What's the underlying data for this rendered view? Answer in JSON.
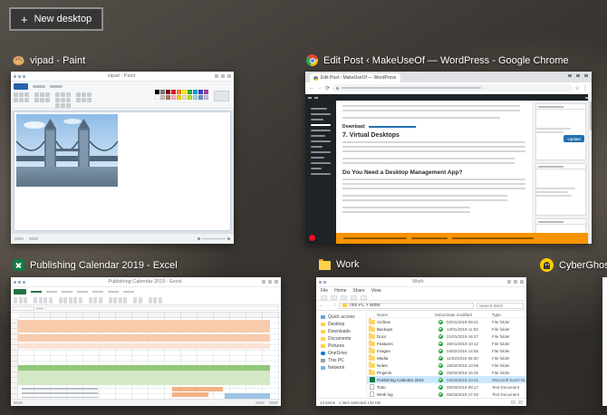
{
  "new_desktop": {
    "label": "New desktop",
    "plus": "+"
  },
  "windows": {
    "paint": {
      "label": "vipad - Paint",
      "title": "vipad - Paint",
      "palette": [
        "#000000",
        "#7f7f7f",
        "#880015",
        "#ed1c24",
        "#ff7f27",
        "#fff200",
        "#22b14c",
        "#00a2e8",
        "#3f48cc",
        "#a349a4",
        "#ffffff",
        "#c3c3c3",
        "#b97a57",
        "#ffaec9",
        "#ffc90e",
        "#efe4b0",
        "#b5e61d",
        "#99d9ea",
        "#7092be",
        "#c8bfe7"
      ]
    },
    "chrome": {
      "label": "Edit Post ‹ MakeUseOf — WordPress - Google Chrome",
      "tab_title": "Edit Post ‹ MakeUseOf — WordPress",
      "heading_virtual_desktops": "7. Virtual Desktops",
      "heading_management": "Do You Need a Desktop Management App?",
      "download_label": "Download:",
      "update_button": "Update"
    },
    "excel": {
      "label": "Publishing Calendar 2019 - Excel",
      "title": "Publishing Calendar 2019 - Excel"
    },
    "explorer": {
      "label": "Work",
      "title": "Work",
      "tabs": [
        "File",
        "Home",
        "Share",
        "View"
      ],
      "breadcrumb": "This PC > Work",
      "search_placeholder": "Search Work",
      "columns": [
        "Name",
        "Status",
        "Date modified",
        "Type"
      ],
      "nav": [
        "Quick access",
        "Desktop",
        "Downloads",
        "Documents",
        "Pictures",
        "OneDrive",
        "This PC",
        "Network"
      ],
      "rows": [
        {
          "name": "Archive",
          "date": "02/01/2019 09:41",
          "type": "File folder"
        },
        {
          "name": "Backups",
          "date": "14/01/2019 11:03",
          "type": "File folder"
        },
        {
          "name": "Docs",
          "date": "21/01/2019 16:27",
          "type": "File folder"
        },
        {
          "name": "Features",
          "date": "28/01/2019 10:12",
          "type": "File folder"
        },
        {
          "name": "Images",
          "date": "04/02/2019 14:55",
          "type": "File folder"
        },
        {
          "name": "Media",
          "date": "11/02/2019 09:30",
          "type": "File folder"
        },
        {
          "name": "Notes",
          "date": "18/02/2019 13:08",
          "type": "File folder"
        },
        {
          "name": "Projects",
          "date": "25/02/2019 15:46",
          "type": "File folder"
        },
        {
          "name": "Publishing Calendar 2019",
          "date": "04/03/2019 10:21",
          "type": "Microsoft Excel W..."
        },
        {
          "name": "Todo",
          "date": "05/03/2019 08:17",
          "type": "Text Document"
        },
        {
          "name": "Work log",
          "date": "06/03/2019 17:02",
          "type": "Text Document"
        }
      ],
      "status_text": "13 items   1 item selected 132 KB"
    },
    "cyberghost": {
      "label": "CyberGhost"
    }
  },
  "colors": {
    "accent_blue": "#0078d7",
    "wordpress_blue": "#2271b1",
    "excel_green": "#107c41",
    "onedrive_synced_green": "#1e9e33",
    "notice_orange": "#f79400",
    "cyberghost_yellow": "#ffcc00"
  }
}
